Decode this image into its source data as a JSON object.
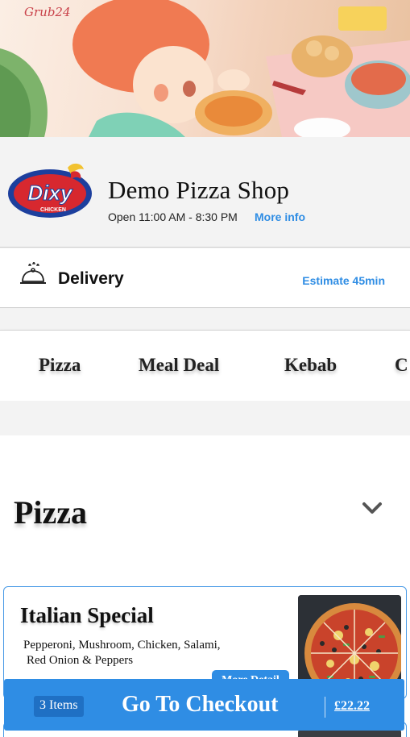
{
  "hero": {
    "brand": "Grub24"
  },
  "shop": {
    "logo_text": "Dixy",
    "logo_subtext": "CHICKEN",
    "name": "Demo Pizza Shop",
    "hours": "Open 11:00 AM - 8:30 PM",
    "more_info": "More info"
  },
  "delivery": {
    "label": "Delivery",
    "estimate": "Estimate 45min"
  },
  "categories": [
    "Pizza",
    "Meal Deal",
    "Kebab",
    "C"
  ],
  "section": {
    "title": "Pizza"
  },
  "products": [
    {
      "title": "Italian Special",
      "description_line1": "Pepperoni, Mushroom, Chicken, Salami,",
      "description_line2": "Red Onion & Peppers",
      "more_detail": "More Detail"
    }
  ],
  "checkout": {
    "items": "3 Items",
    "label": "Go To Checkout",
    "total": "£22.22"
  },
  "colors": {
    "accent": "#2f8de4",
    "card_border": "#4a9be6"
  },
  "icons": [
    "cloche-icon",
    "chevron-down-icon"
  ]
}
